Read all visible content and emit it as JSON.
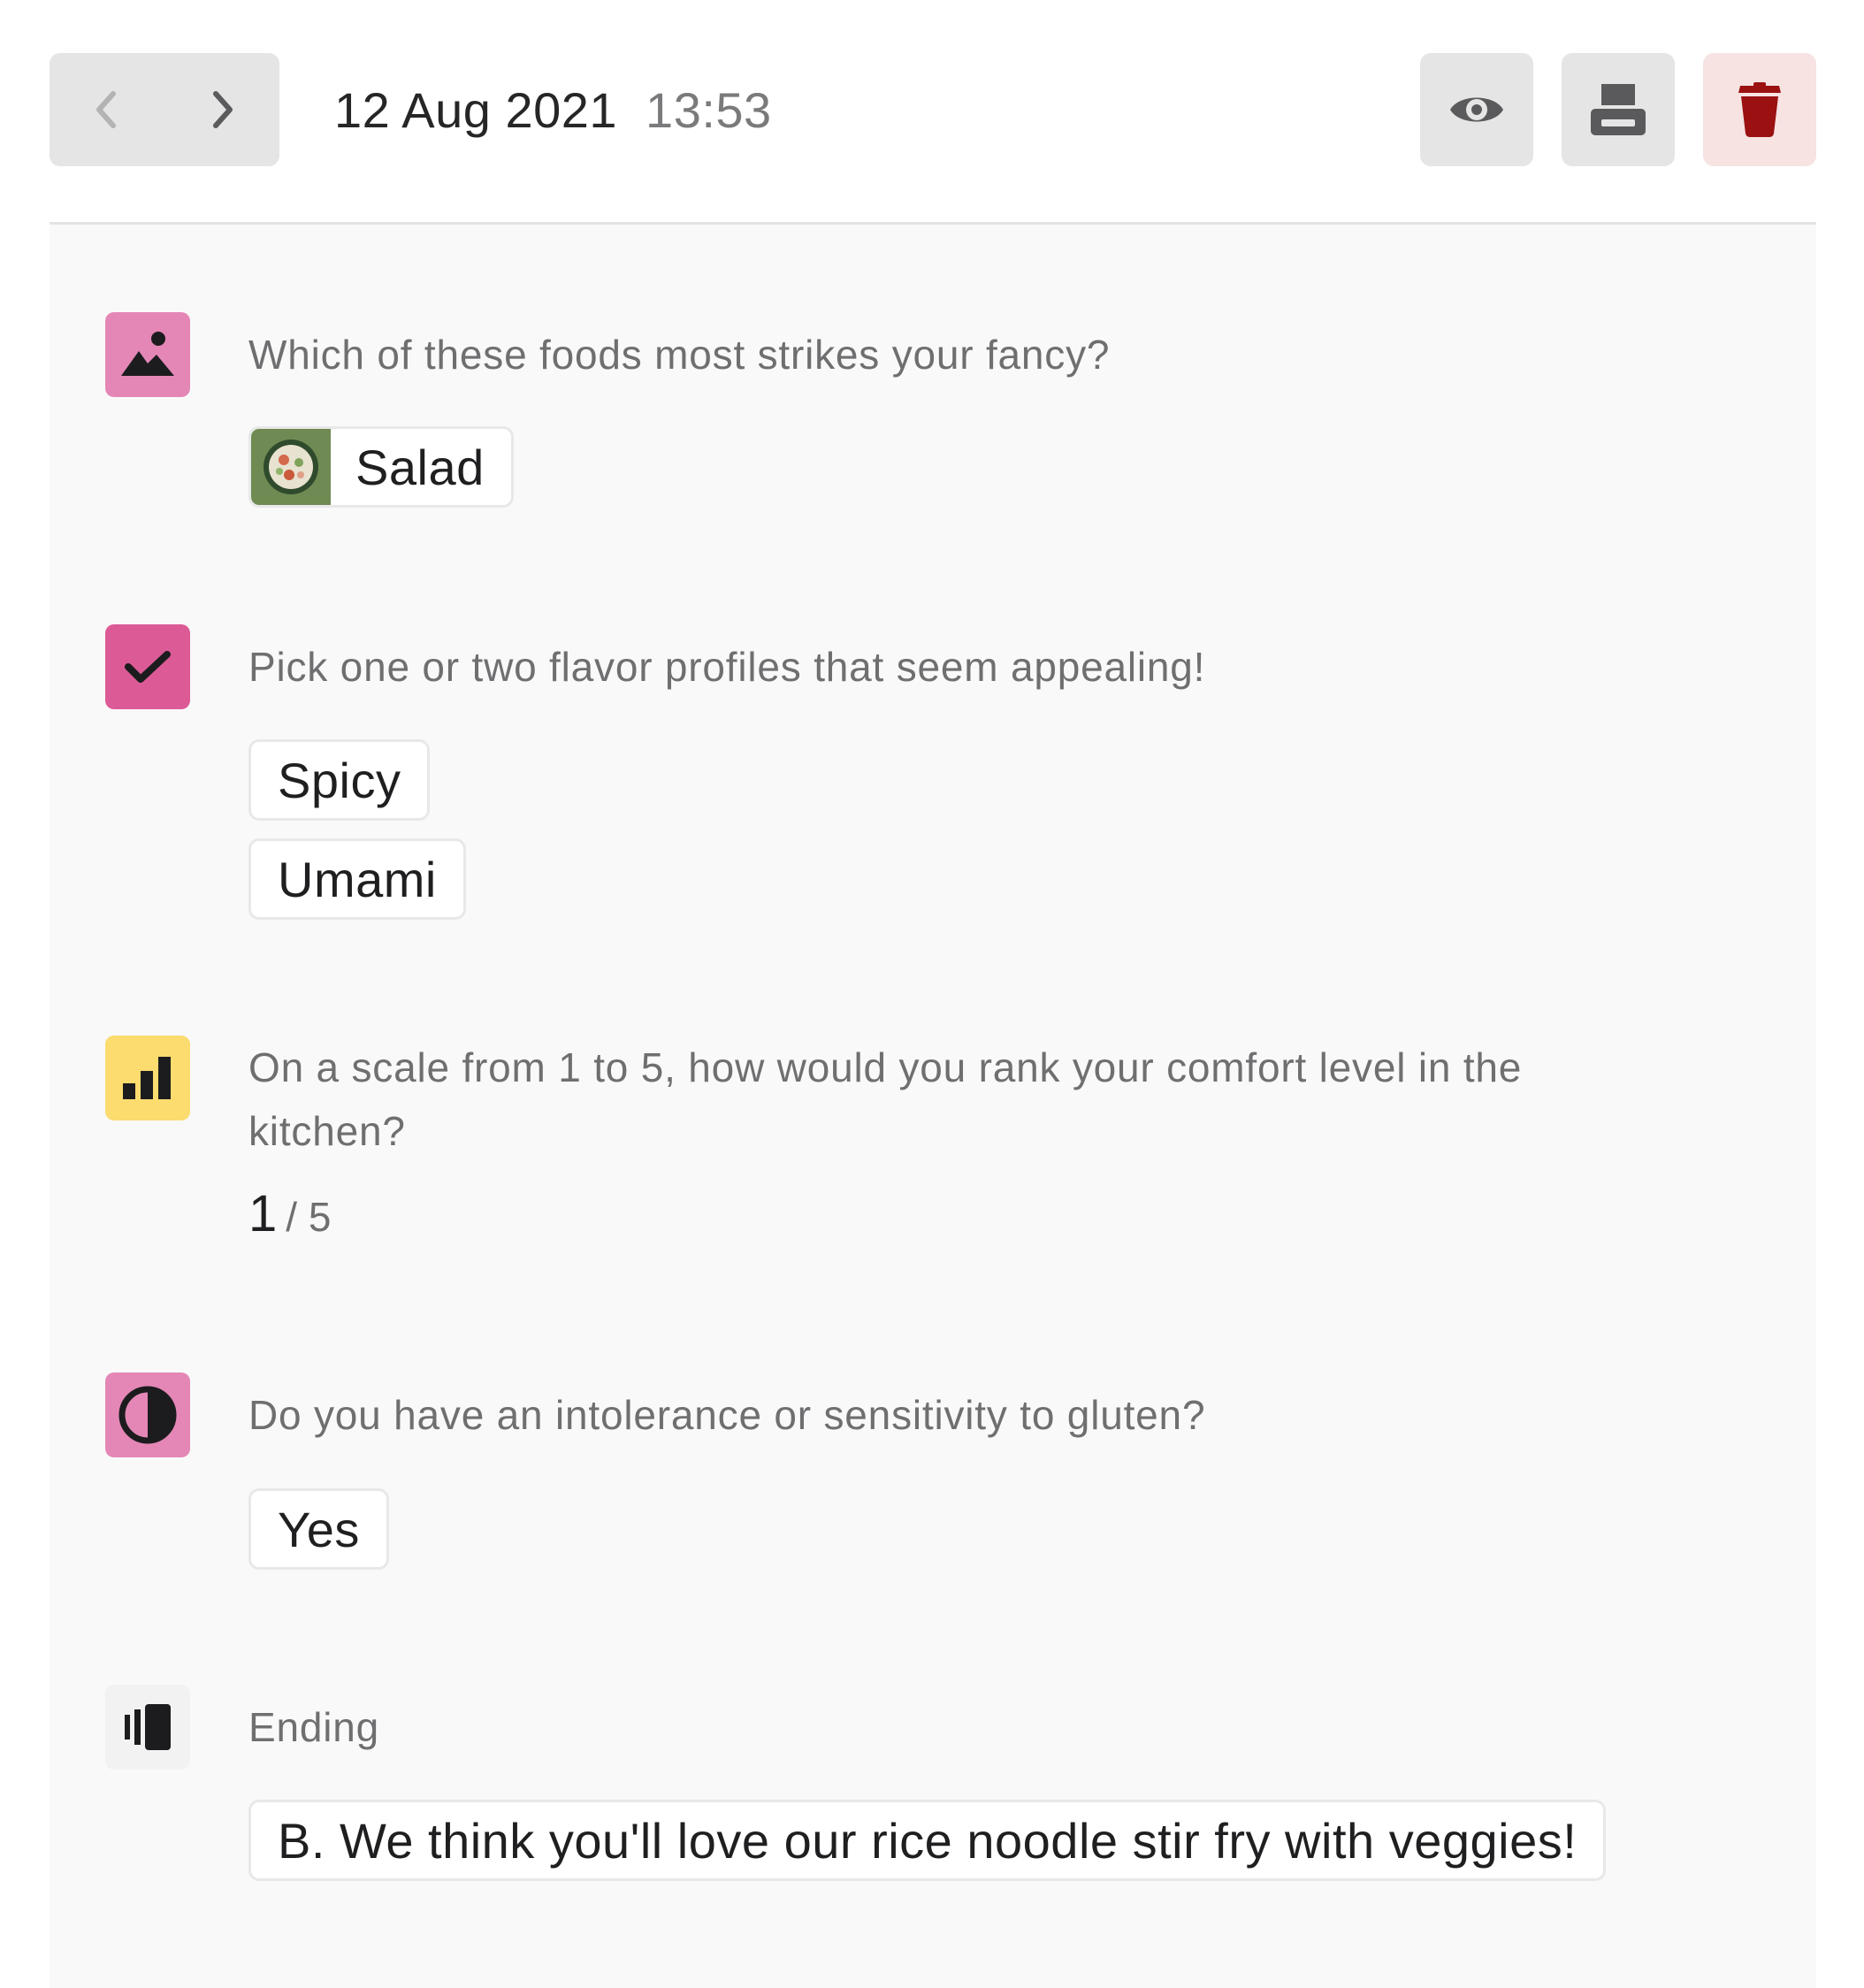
{
  "header": {
    "date": "12 Aug 2021",
    "time": "13:53",
    "prev_icon": "chevron-left-icon",
    "next_icon": "chevron-right-icon",
    "actions": [
      "eye-icon",
      "printer-icon",
      "trash-icon"
    ],
    "delete_color": "#9b1010"
  },
  "questions": [
    {
      "icon": "picture-choice-icon",
      "icon_color": "#e487b6",
      "text": "Which of these foods most strikes your fancy?",
      "answers": [
        "Salad"
      ],
      "answer_thumbnail": "salad-thumbnail"
    },
    {
      "icon": "checkbox-icon",
      "icon_color": "#dc5b96",
      "text": "Pick one or two flavor profiles that seem appealing!",
      "answers": [
        "Spicy",
        "Umami"
      ]
    },
    {
      "icon": "bar-chart-icon",
      "icon_color": "#fcdb6f",
      "text": "On a scale from 1 to 5, how would you rank your comfort level in the kitchen?",
      "rating": {
        "value": "1",
        "max": "/ 5"
      }
    },
    {
      "icon": "half-circle-icon",
      "icon_color": "#e487b6",
      "text": "Do you have an intolerance or sensitivity to gluten?",
      "answers": [
        "Yes"
      ]
    },
    {
      "icon": "ending-icon",
      "icon_color": "#f2f2f2",
      "text": "Ending",
      "answers": [
        "B. We think you'll love our rice noodle stir fry with veggies!"
      ]
    }
  ]
}
